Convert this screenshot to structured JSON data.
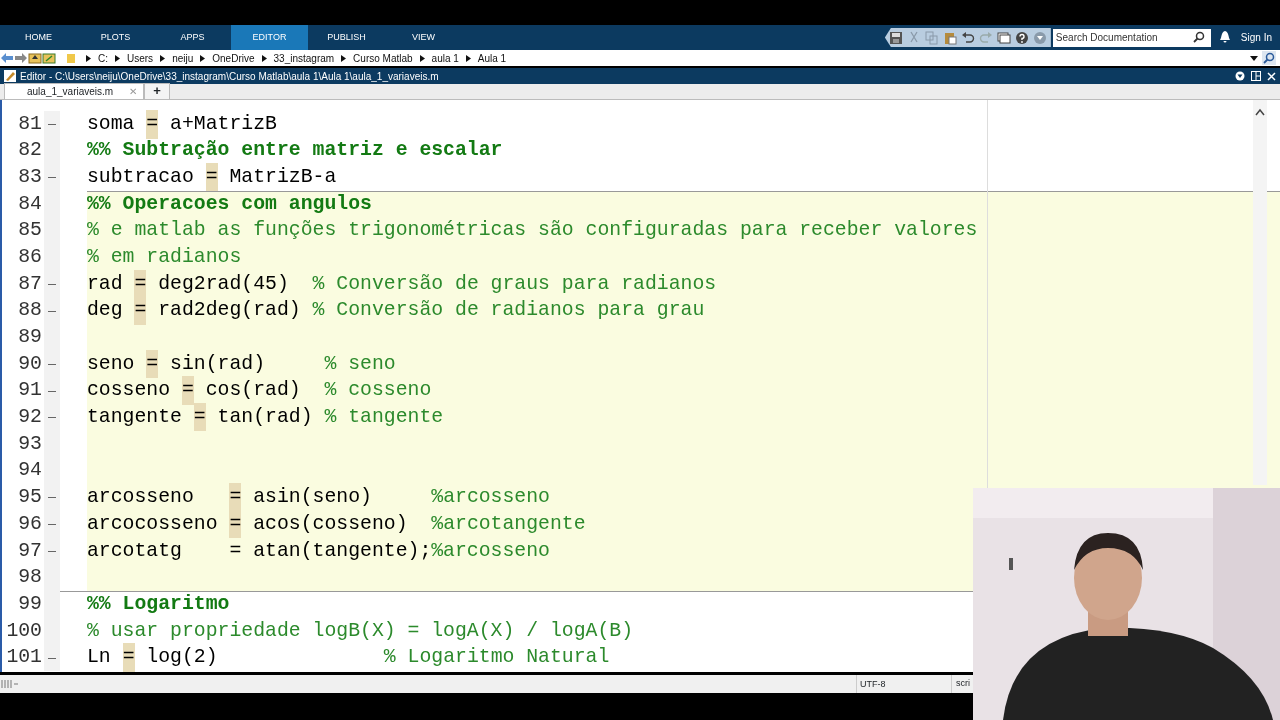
{
  "ribbon": {
    "tabs": [
      {
        "label": "HOME",
        "selected": false
      },
      {
        "label": "PLOTS",
        "selected": false
      },
      {
        "label": "APPS",
        "selected": false
      },
      {
        "label": "EDITOR",
        "selected": true
      },
      {
        "label": "PUBLISH",
        "selected": false
      },
      {
        "label": "VIEW",
        "selected": false
      }
    ],
    "search": {
      "placeholder": "Search Documentation"
    },
    "sign_in": "Sign In"
  },
  "path": [
    "C:",
    "Users",
    "neiju",
    "OneDrive",
    "33_instagram",
    "Curso Matlab",
    "aula 1",
    "Aula 1"
  ],
  "editor": {
    "title": "Editor - C:\\Users\\neiju\\OneDrive\\33_instagram\\Curso Matlab\\aula 1\\Aula 1\\aula_1_variaveis.m",
    "tabs": [
      {
        "label": "aula_1_variaveis.m",
        "selected": true,
        "close": "✕"
      }
    ],
    "new_tab": "+",
    "lines": [
      {
        "number": "81",
        "executable": true,
        "in_cell": false,
        "parts": [
          {
            "kind": "code",
            "text": "soma "
          },
          {
            "kind": "flag",
            "text": "="
          },
          {
            "kind": "code",
            "text": " a+MatrizB"
          }
        ]
      },
      {
        "number": "82",
        "executable": false,
        "in_cell": false,
        "parts": [
          {
            "kind": "section",
            "text": "%% Subtração entre matriz e escalar"
          }
        ]
      },
      {
        "number": "83",
        "executable": true,
        "in_cell": false,
        "parts": [
          {
            "kind": "code",
            "text": "subtracao "
          },
          {
            "kind": "flag",
            "text": "="
          },
          {
            "kind": "code",
            "text": " MatrizB-a"
          }
        ]
      },
      {
        "number": "84",
        "executable": false,
        "in_cell": true,
        "parts": [
          {
            "kind": "section",
            "text": "%% Operacoes com angulos"
          }
        ]
      },
      {
        "number": "85",
        "executable": false,
        "in_cell": true,
        "parts": [
          {
            "kind": "comment",
            "text": "% e matlab as funções trigonométricas são configuradas para receber valores"
          }
        ]
      },
      {
        "number": "86",
        "executable": false,
        "in_cell": true,
        "parts": [
          {
            "kind": "comment",
            "text": "% em radianos"
          }
        ]
      },
      {
        "number": "87",
        "executable": true,
        "in_cell": true,
        "parts": [
          {
            "kind": "code",
            "text": "rad "
          },
          {
            "kind": "flag",
            "text": "="
          },
          {
            "kind": "code",
            "text": " deg2rad(45)  "
          },
          {
            "kind": "comment",
            "text": "% Conversão de graus para radianos"
          }
        ]
      },
      {
        "number": "88",
        "executable": true,
        "in_cell": true,
        "parts": [
          {
            "kind": "code",
            "text": "deg "
          },
          {
            "kind": "flag",
            "text": "="
          },
          {
            "kind": "code",
            "text": " rad2deg(rad) "
          },
          {
            "kind": "comment",
            "text": "% Conversão de radianos para grau"
          }
        ]
      },
      {
        "number": "89",
        "executable": false,
        "in_cell": true
      },
      {
        "number": "90",
        "executable": true,
        "in_cell": true,
        "parts": [
          {
            "kind": "code",
            "text": "seno "
          },
          {
            "kind": "flag",
            "text": "="
          },
          {
            "kind": "code",
            "text": " sin(rad)     "
          },
          {
            "kind": "comment",
            "text": "% seno"
          }
        ]
      },
      {
        "number": "91",
        "executable": true,
        "in_cell": true,
        "parts": [
          {
            "kind": "code",
            "text": "cosseno "
          },
          {
            "kind": "flag",
            "text": "="
          },
          {
            "kind": "code",
            "text": " cos(rad)  "
          },
          {
            "kind": "comment",
            "text": "% cosseno"
          }
        ]
      },
      {
        "number": "92",
        "executable": true,
        "in_cell": true,
        "parts": [
          {
            "kind": "code",
            "text": "tangente "
          },
          {
            "kind": "flag",
            "text": "="
          },
          {
            "kind": "code",
            "text": " tan(rad) "
          },
          {
            "kind": "comment",
            "text": "% tangente"
          }
        ]
      },
      {
        "number": "93",
        "executable": false,
        "in_cell": true
      },
      {
        "number": "94",
        "executable": false,
        "in_cell": true
      },
      {
        "number": "95",
        "executable": true,
        "in_cell": true,
        "parts": [
          {
            "kind": "code",
            "text": "arcosseno   "
          },
          {
            "kind": "flag",
            "text": "="
          },
          {
            "kind": "code",
            "text": " asin(seno)     "
          },
          {
            "kind": "comment",
            "text": "%arcosseno"
          }
        ]
      },
      {
        "number": "96",
        "executable": true,
        "in_cell": true,
        "parts": [
          {
            "kind": "code",
            "text": "arcocosseno "
          },
          {
            "kind": "flag",
            "text": "="
          },
          {
            "kind": "code",
            "text": " acos(cosseno)  "
          },
          {
            "kind": "comment",
            "text": "%arcotangente"
          }
        ]
      },
      {
        "number": "97",
        "executable": true,
        "in_cell": true,
        "parts": [
          {
            "kind": "code",
            "text": "arcotatg    = atan(tangente);"
          },
          {
            "kind": "comment",
            "text": "%arcosseno"
          }
        ]
      },
      {
        "number": "98",
        "executable": false,
        "in_cell": true
      },
      {
        "number": "99",
        "executable": false,
        "in_cell": false,
        "parts": [
          {
            "kind": "section",
            "text": "%% Logaritmo"
          }
        ]
      },
      {
        "number": "100",
        "executable": false,
        "in_cell": false,
        "parts": [
          {
            "kind": "comment",
            "text": "% usar propriedade logB(X) = logA(X) / logA(B)"
          }
        ]
      },
      {
        "number": "101",
        "executable": true,
        "in_cell": false,
        "parts": [
          {
            "kind": "code",
            "text": "Ln "
          },
          {
            "kind": "flag",
            "text": "="
          },
          {
            "kind": "code",
            "text": " log(2)              "
          },
          {
            "kind": "comment",
            "text": "% Logaritmo Natural"
          }
        ]
      }
    ]
  },
  "status_bar": {
    "encoding": "UTF-8",
    "type": "scri"
  }
}
